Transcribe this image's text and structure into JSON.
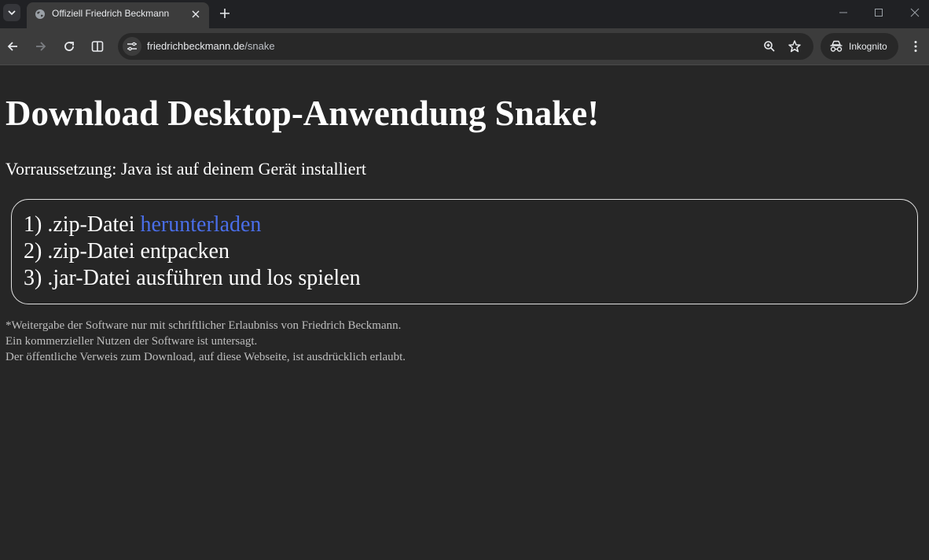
{
  "browser": {
    "tab": {
      "title": "Offiziell Friedrich Beckmann"
    },
    "address": {
      "host": "friedrichbeckmann.de",
      "path": "/snake"
    },
    "profile_label": "Inkognito"
  },
  "page": {
    "title": "Download Desktop-Anwendung Snake!",
    "requirement": "Vorraussetzung: Java ist auf deinem Gerät installiert",
    "steps": [
      {
        "prefix": "1) .zip-Datei ",
        "link": "herunterladen"
      },
      {
        "text": "2) .zip-Datei entpacken"
      },
      {
        "text": "3) .jar-Datei ausführen und los spielen"
      }
    ],
    "footnote": [
      "*Weitergabe der Software nur mit schriftlicher Erlaubniss von Friedrich Beckmann.",
      "Ein kommerzieller Nutzen der Software ist untersagt.",
      "Der öffentliche Verweis zum Download, auf diese Webseite, ist ausdrücklich erlaubt."
    ]
  },
  "colors": {
    "page_background": "#262626",
    "link": "#4a6ee8",
    "footnote_text": "#bdbdbd"
  },
  "icons": [
    "tab-search-icon",
    "globe-icon",
    "close-icon",
    "plus-icon",
    "minimize-icon",
    "maximize-icon",
    "window-close-icon",
    "back-arrow-icon",
    "forward-arrow-icon",
    "reload-icon",
    "split-view-icon",
    "site-info-icon",
    "zoom-icon",
    "star-icon",
    "incognito-icon",
    "kebab-menu-icon"
  ]
}
